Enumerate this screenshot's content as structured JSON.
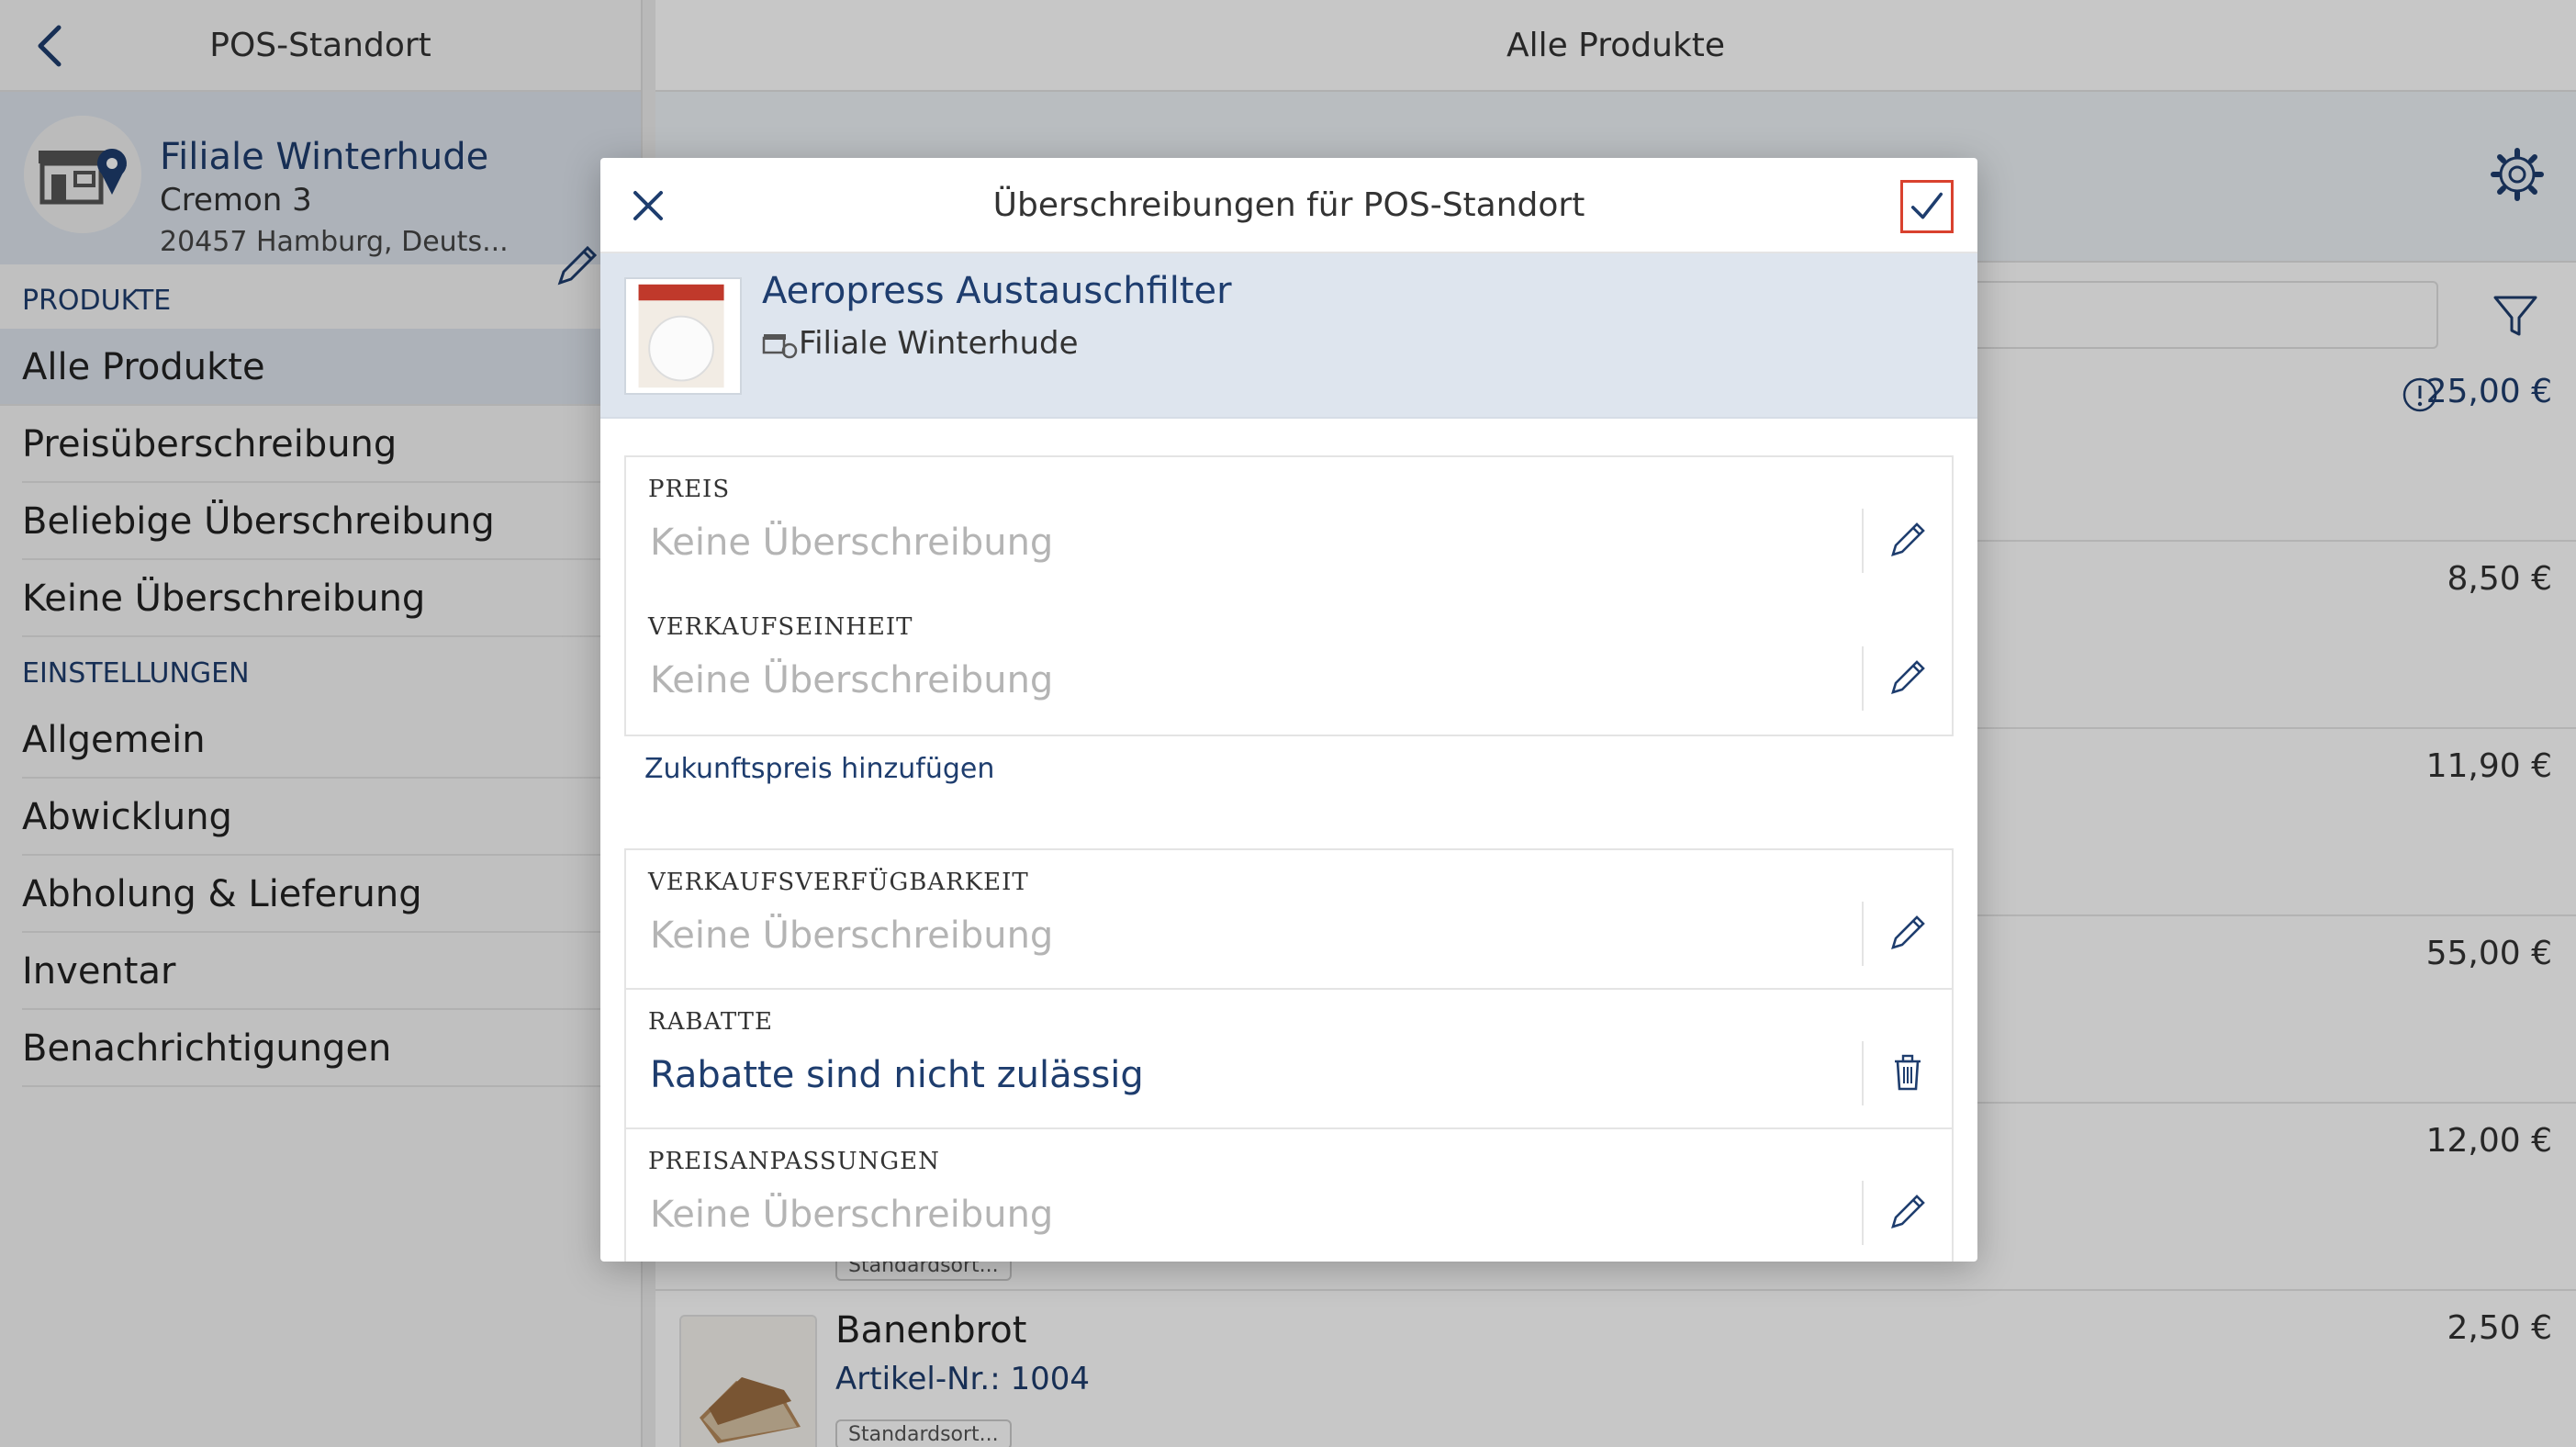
{
  "left": {
    "header_title": "POS-Standort",
    "store": {
      "name": "Filiale Winterhude",
      "street": "Cremon 3",
      "city": "20457 Hamburg, Deuts..."
    },
    "sections": [
      {
        "title": "PRODUKTE",
        "items": [
          "Alle Produkte",
          "Preisüberschreibung",
          "Beliebige Überschreibung",
          "Keine Überschreibung"
        ]
      },
      {
        "title": "EINSTELLUNGEN",
        "items": [
          "Allgemein",
          "Abwicklung",
          "Abholung & Lieferung",
          "Inventar",
          "Benachrichtigungen"
        ]
      }
    ]
  },
  "right": {
    "header_title": "Alle Produkte",
    "prices": [
      "25,00 €",
      "8,50 €",
      "11,90 €",
      "55,00 €",
      "12,00 €",
      "2,50 €"
    ],
    "last_product": {
      "name": "Banenbrot",
      "article": "Artikel-Nr.: 1004",
      "tag": "Standardsort..."
    },
    "peek_tag": "Standardsort..."
  },
  "modal": {
    "title": "Überschreibungen für POS-Standort",
    "product_name": "Aeropress Austauschfilter",
    "product_store": "Filiale Winterhude",
    "fields_1": [
      {
        "label": "PREIS",
        "value": "Keine Überschreibung"
      },
      {
        "label": "VERKAUFSEINHEIT",
        "value": "Keine Überschreibung"
      }
    ],
    "future_price_link": "Zukunftspreis hinzufügen",
    "fields_2": [
      {
        "label": "VERKAUFSVERFÜGBARKEIT",
        "value": "Keine Überschreibung"
      },
      {
        "label": "RABATTE",
        "value": "Rabatte sind nicht zulässig"
      },
      {
        "label": "PREISANPASSUNGEN",
        "value": "Keine Überschreibung"
      }
    ]
  }
}
